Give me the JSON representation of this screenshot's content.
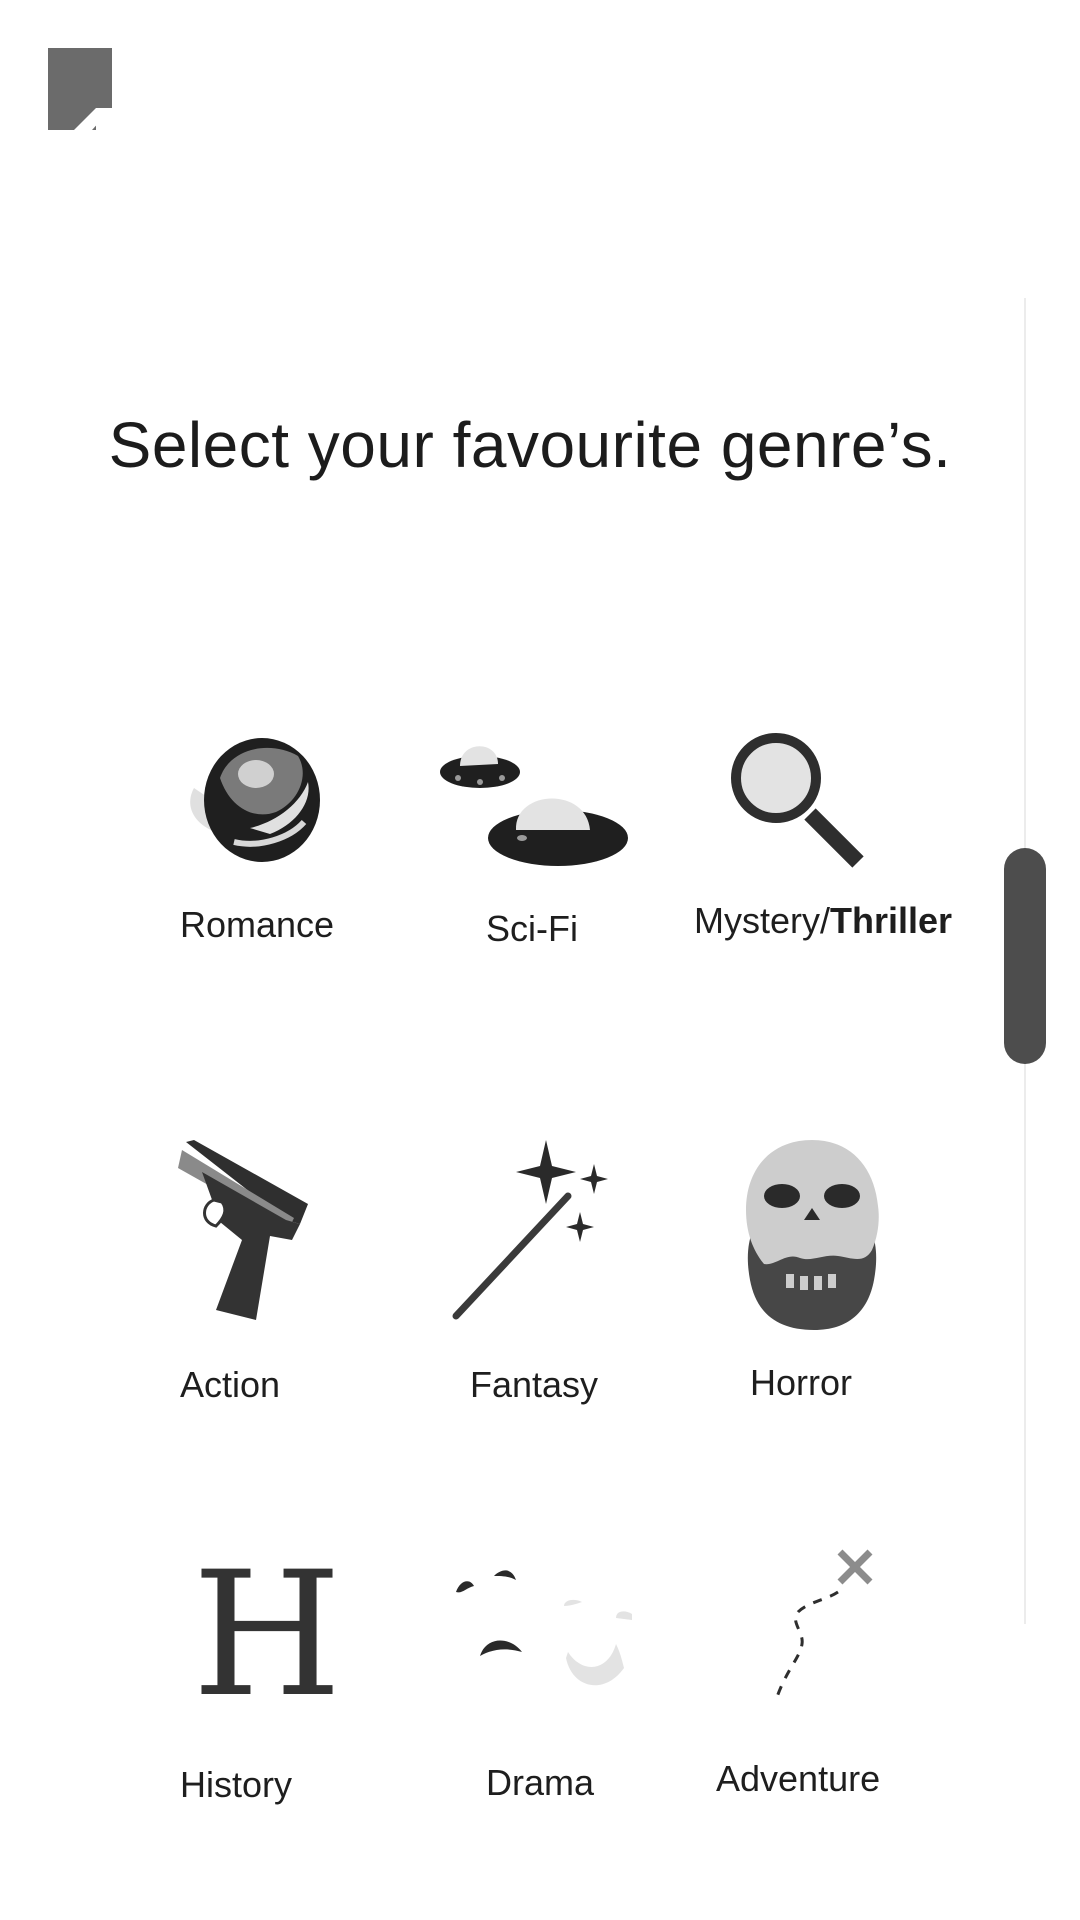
{
  "header": {
    "logo_icon": "bookmark-logo-icon"
  },
  "title": "Select your favourite genre’s.",
  "genres": [
    {
      "label": "Romance",
      "icon": "rose-icon"
    },
    {
      "label": "Sci-Fi",
      "icon": "ufo-icon"
    },
    {
      "label_a": "Mystery/",
      "label_b": "Thriller",
      "icon": "magnifying-glass-icon"
    },
    {
      "label": "Action",
      "icon": "pistol-icon"
    },
    {
      "label": "Fantasy",
      "icon": "magic-wand-icon"
    },
    {
      "label": "Horror",
      "icon": "skull-icon"
    },
    {
      "label": "History",
      "icon": "letter-h-icon",
      "glyph": "H"
    },
    {
      "label": "Drama",
      "icon": "theater-masks-icon"
    },
    {
      "label": "Adventure",
      "icon": "treasure-map-path-icon"
    }
  ],
  "colors": {
    "icon_dark": "#333333",
    "icon_mid": "#777777",
    "icon_light": "#e3e3e3",
    "scrollbar": "#4d4d4d"
  }
}
